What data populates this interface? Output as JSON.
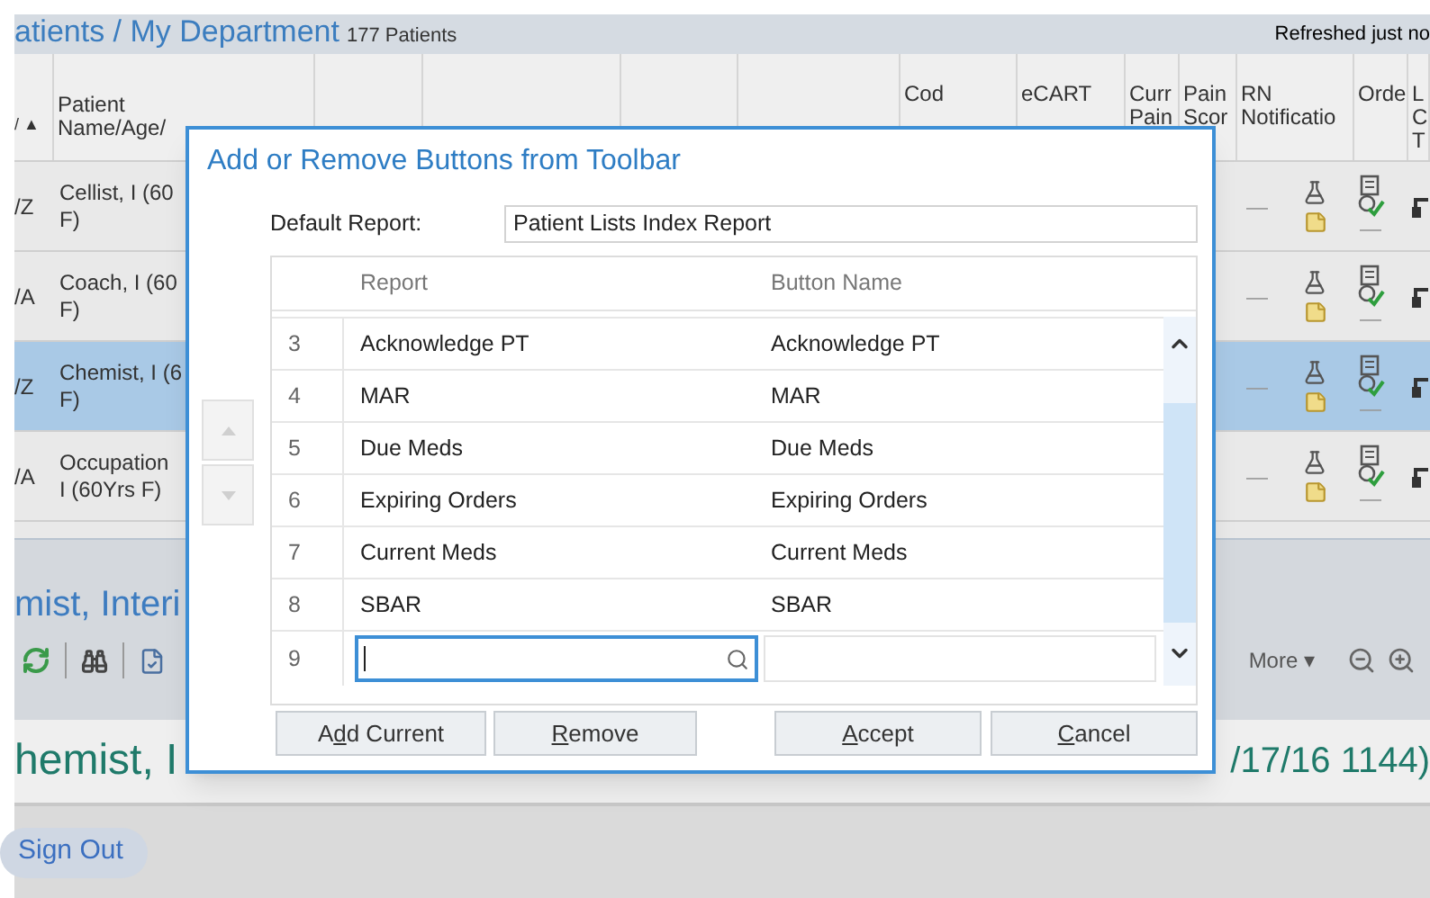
{
  "header": {
    "title": "atients / My Department",
    "count": "177 Patients",
    "refreshed": "Refreshed just no"
  },
  "columns_left": [
    "/ ▲",
    "Patient Name/Age/"
  ],
  "columns_right": [
    "Cod",
    "eCART",
    "Curr Pain",
    "Pain Scor",
    "RN Notificatio",
    "Orde",
    "L C T"
  ],
  "rows": [
    {
      "fragment": "/Z",
      "name_lines": [
        "Cellist, I (60",
        "F)"
      ],
      "selected": false,
      "dash": "—",
      "order_dash": "—"
    },
    {
      "fragment": "/A",
      "name_lines": [
        "Coach, I (60",
        "F)"
      ],
      "selected": false,
      "dash": "—",
      "order_dash": "—"
    },
    {
      "fragment": "/Z",
      "name_lines": [
        "Chemist, I (6",
        "F)"
      ],
      "selected": true,
      "dash": "—",
      "order_dash": "—"
    },
    {
      "fragment": "/A",
      "name_lines": [
        "Occupation",
        "I (60Yrs F)"
      ],
      "selected": false,
      "dash": "—",
      "order_dash": "—"
    }
  ],
  "banner": {
    "name": "mist, Interi",
    "more": "More ▾"
  },
  "encounter": {
    "left": "hemist, I",
    "right": "/17/16 1144)"
  },
  "sign_out": "Sign Out",
  "dialog": {
    "title": "Add or Remove Buttons from Toolbar",
    "default_label": "Default Report:",
    "default_value": "Patient Lists Index Report",
    "columns": [
      "Report",
      "Button Name"
    ],
    "move_buttons": [
      {
        "kind": "up",
        "disabled": true
      },
      {
        "kind": "down",
        "disabled": true
      }
    ],
    "rows": [
      {
        "number": "3",
        "report": "Acknowledge PT",
        "button_name": "Acknowledge PT"
      },
      {
        "number": "4",
        "report": "MAR",
        "button_name": "MAR"
      },
      {
        "number": "5",
        "report": "Due Meds",
        "button_name": "Due Meds"
      },
      {
        "number": "6",
        "report": "Expiring Orders",
        "button_name": "Expiring Orders"
      },
      {
        "number": "7",
        "report": "Current Meds",
        "button_name": "Current Meds"
      },
      {
        "number": "8",
        "report": "SBAR",
        "button_name": "SBAR"
      }
    ],
    "new_row": {
      "number": "9",
      "focused": true
    },
    "left_buttons": [
      {
        "parts": [
          {
            "text": "A",
            "underlined": false
          },
          {
            "text": "d",
            "underlined": true
          },
          {
            "text": "d Current",
            "underlined": false
          }
        ]
      },
      {
        "parts": [
          {
            "text": "R",
            "underlined": true
          },
          {
            "text": "emove",
            "underlined": false
          }
        ]
      }
    ],
    "right_buttons": [
      {
        "parts": [
          {
            "text": "A",
            "underlined": true
          },
          {
            "text": "ccept",
            "underlined": false
          }
        ]
      },
      {
        "parts": [
          {
            "text": "C",
            "underlined": true
          },
          {
            "text": "ancel",
            "underlined": false
          }
        ]
      }
    ]
  }
}
